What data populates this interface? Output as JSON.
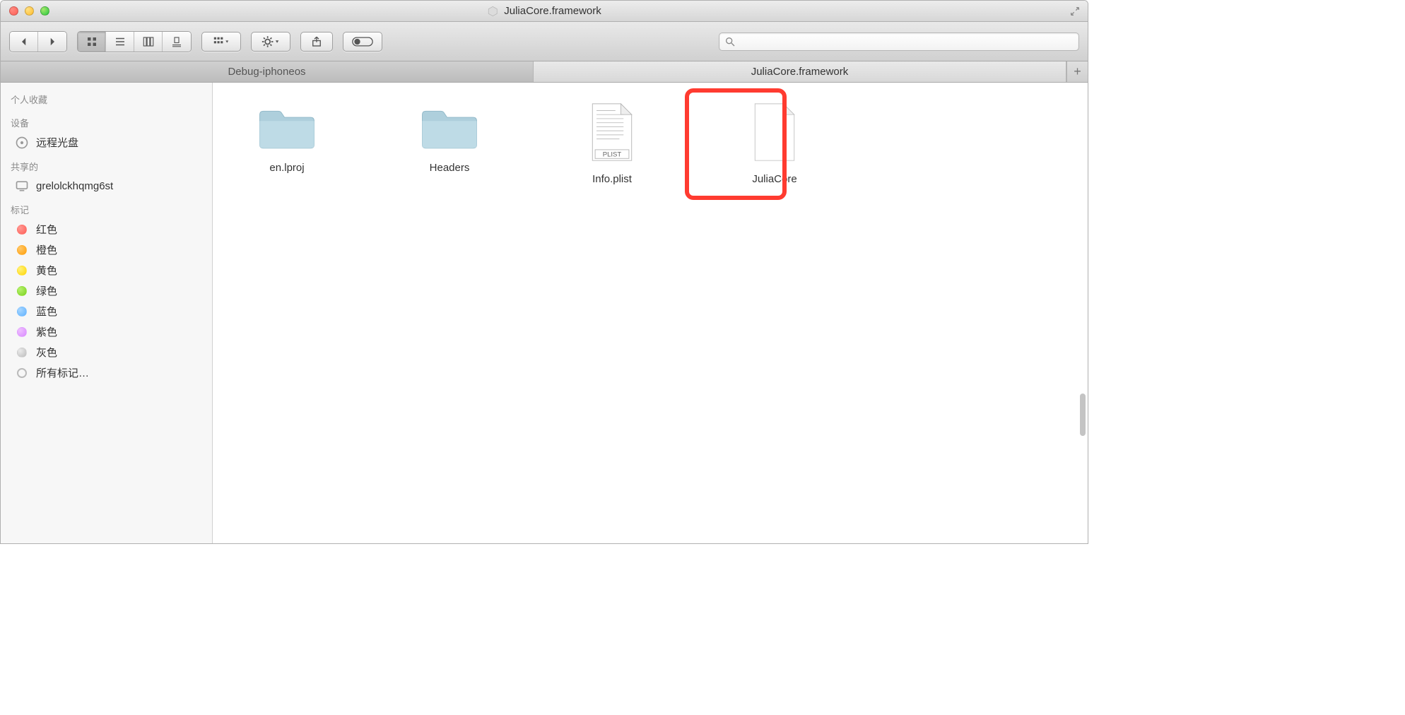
{
  "window": {
    "title": "JuliaCore.framework"
  },
  "toolbar": {
    "search_placeholder": ""
  },
  "tabs": [
    {
      "label": "Debug-iphoneos",
      "active": false
    },
    {
      "label": "JuliaCore.framework",
      "active": true
    }
  ],
  "sidebar": {
    "sections": {
      "favorites": {
        "header": "个人收藏"
      },
      "devices": {
        "header": "设备",
        "items": [
          {
            "label": "远程光盘"
          }
        ]
      },
      "shared": {
        "header": "共享的",
        "items": [
          {
            "label": "grelolckhqmg6st"
          }
        ]
      },
      "tags": {
        "header": "标记",
        "items": [
          {
            "label": "红色"
          },
          {
            "label": "橙色"
          },
          {
            "label": "黄色"
          },
          {
            "label": "绿色"
          },
          {
            "label": "蓝色"
          },
          {
            "label": "紫色"
          },
          {
            "label": "灰色"
          },
          {
            "label": "所有标记…"
          }
        ]
      }
    }
  },
  "content": {
    "items": [
      {
        "name": "en.lproj",
        "type": "folder"
      },
      {
        "name": "Headers",
        "type": "folder"
      },
      {
        "name": "Info.plist",
        "type": "plist"
      },
      {
        "name": "JuliaCore",
        "type": "file",
        "highlighted": true
      }
    ]
  }
}
